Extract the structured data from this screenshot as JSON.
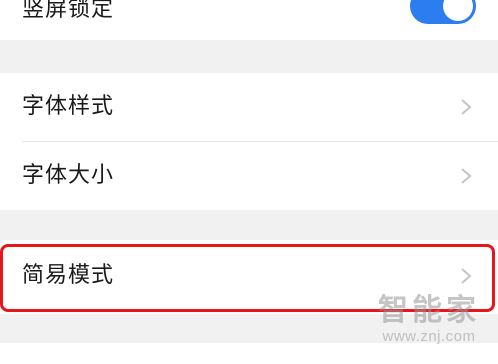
{
  "rows": {
    "rotation_lock": {
      "label": "竖屏锁定",
      "toggle_on": true
    },
    "font_style": {
      "label": "字体样式"
    },
    "font_size": {
      "label": "字体大小"
    },
    "simple_mode": {
      "label": "简易模式"
    }
  },
  "watermark": {
    "title": "智能家",
    "url": "www.znj.com"
  },
  "colors": {
    "toggle_accent": "#2b7df0",
    "highlight_border": "#e8161b",
    "background": "#f1f1f1"
  },
  "icons": {
    "chevron": "chevron-right-icon"
  }
}
